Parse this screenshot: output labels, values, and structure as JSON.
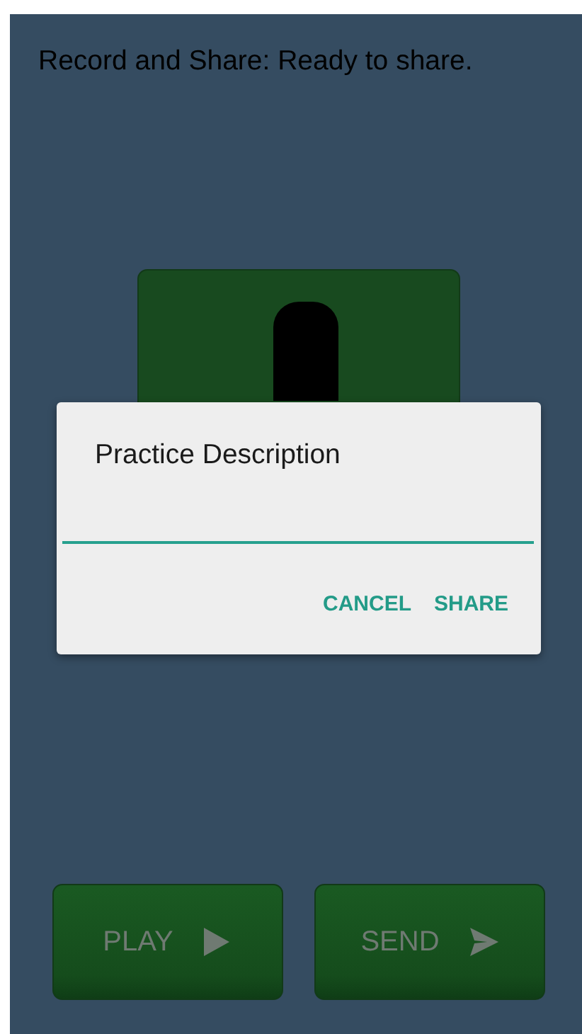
{
  "status_text": "Record and Share: Ready to share.",
  "dialog": {
    "title": "Practice Description",
    "actions": [
      "CANCEL",
      "SHARE"
    ]
  },
  "buttons": [
    {
      "label": "PLAY",
      "kind": "play"
    },
    {
      "label": "SEND",
      "kind": "send"
    }
  ]
}
